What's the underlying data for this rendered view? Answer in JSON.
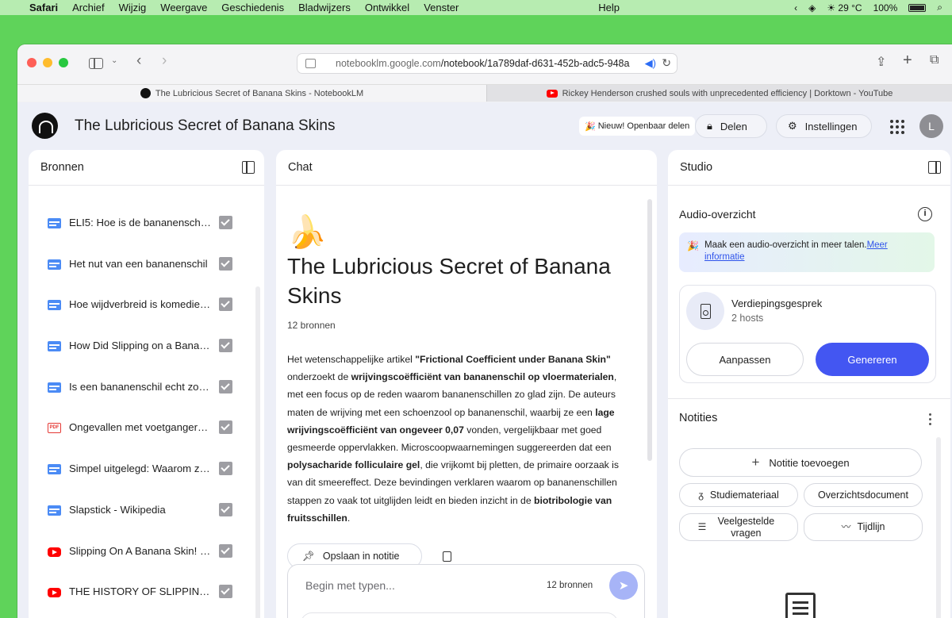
{
  "menubar": {
    "apple": "",
    "items": [
      "Safari",
      "Archief",
      "Wijzig",
      "Weergave",
      "Geschiedenis",
      "Bladwijzers",
      "Ontwikkel",
      "Venster",
      "Help"
    ],
    "weather": "☀ 29 °C",
    "battery": "100%"
  },
  "browser": {
    "url_host": "notebooklm.google.com",
    "url_path": "/notebook/1a789daf-d631-452b-adc5-948a",
    "tabs": [
      {
        "title": "The Lubricious Secret of Banana Skins - NotebookLM"
      },
      {
        "title": "Rickey Henderson crushed souls with unprecedented efficiency | Dorktown - YouTube"
      }
    ]
  },
  "header": {
    "title": "The Lubricious Secret of Banana Skins",
    "new_badge": "Nieuw! Openbaar delen",
    "share": "Delen",
    "settings": "Instellingen",
    "avatar_initial": "L"
  },
  "sources": {
    "heading": "Bronnen",
    "items": [
      {
        "label": "ELI5: Hoe is de bananenschil glad?",
        "type": "doc"
      },
      {
        "label": "Het nut van een bananenschil",
        "type": "doc"
      },
      {
        "label": "Hoe wijdverbreid is komedie met bananenschillen?",
        "type": "doc"
      },
      {
        "label": "How Did Slipping on a Banana Peel Become a Joke?",
        "type": "doc"
      },
      {
        "label": "Is een bananenschil echt zo glad?",
        "type": "doc"
      },
      {
        "label": "Ongevallen met voetgangers en bananenschillen",
        "type": "pdf"
      },
      {
        "label": "Simpel uitgelegd: Waarom zijn bananenschillen glad?",
        "type": "doc"
      },
      {
        "label": "Slapstick - Wikipedia",
        "type": "doc"
      },
      {
        "label": "Slipping On A Banana Skin! | History",
        "type": "yt"
      },
      {
        "label": "THE HISTORY OF SLIPPING ON A BANANA PEEL",
        "type": "yt"
      }
    ],
    "pdf_badge": "PDF"
  },
  "chat": {
    "heading": "Chat",
    "emoji": "🍌",
    "title": "The Lubricious Secret of Banana Skins",
    "source_count": "12 bronnen",
    "body": {
      "p1": "Het wetenschappelijke artikel ",
      "b1": "\"Frictional Coefficient under Banana Skin\"",
      "p2": " onderzoekt de ",
      "b2": "wrijvingscoëfficiënt van bananenschil op vloermaterialen",
      "p3": ", met een focus op de reden waarom bananenschillen zo glad zijn. De auteurs maten de wrijving met een schoenzool op bananenschil, waarbij ze een ",
      "b3": "lage wrijvingscoëfficiënt van ongeveer 0,07",
      "p4": " vonden, vergelijkbaar met goed gesmeerde oppervlakken. Microscoopwaarnemingen suggereerden dat een ",
      "b4": "polysacharide folliculaire gel",
      "p5": ", die vrijkomt bij pletten, de primaire oorzaak is van dit smeereffect. Deze bevindingen verklaren waarom op bananenschillen stappen zo vaak tot uitglijden leidt en bieden inzicht in de ",
      "b5": "biotribologie van fruitsschillen",
      "p6": "."
    },
    "save_note": "Opslaan in notitie",
    "input_placeholder": "Begin met typen...",
    "input_source_count": "12 bronnen"
  },
  "studio": {
    "heading": "Studio",
    "audio_title": "Audio-overzicht",
    "banner_text": "Maak een audio-overzicht in meer talen.",
    "banner_link": "Meer informatie",
    "card_title": "Verdiepingsgesprek",
    "card_sub": "2 hosts",
    "adjust": "Aanpassen",
    "generate": "Genereren",
    "notes_title": "Notities",
    "add_note": "Notitie toevoegen",
    "chips": {
      "study": "Studiemateriaal",
      "overview": "Overzichtsdocument",
      "faq": "Veelgestelde vragen",
      "timeline": "Tijdlijn"
    }
  }
}
